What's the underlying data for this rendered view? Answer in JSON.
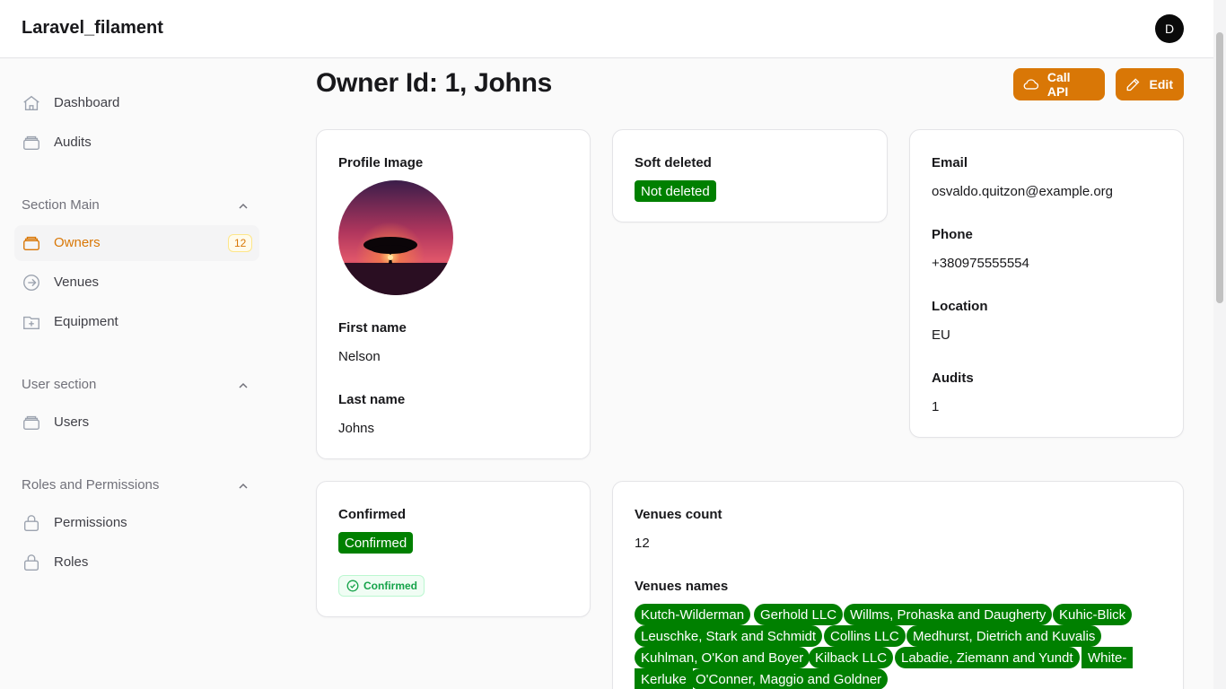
{
  "app": {
    "brand": "Laravel_filament",
    "user_initial": "D"
  },
  "sidebar": {
    "top_items": [
      {
        "label": "Dashboard",
        "icon": "home-icon"
      },
      {
        "label": "Audits",
        "icon": "stack-icon"
      }
    ],
    "groups": [
      {
        "title": "Section Main",
        "items": [
          {
            "label": "Owners",
            "icon": "stack-icon",
            "badge": "12",
            "active": true
          },
          {
            "label": "Venues",
            "icon": "arrow-circle-icon"
          },
          {
            "label": "Equipment",
            "icon": "folder-plus-icon"
          }
        ]
      },
      {
        "title": "User section",
        "items": [
          {
            "label": "Users",
            "icon": "stack-icon"
          }
        ]
      },
      {
        "title": "Roles and Permissions",
        "items": [
          {
            "label": "Permissions",
            "icon": "lock-icon"
          },
          {
            "label": "Roles",
            "icon": "lock-icon"
          }
        ]
      }
    ]
  },
  "header": {
    "title": "Owner Id: 1, Johns",
    "actions": {
      "call_api": "Call API",
      "edit": "Edit"
    },
    "accent_color": "#d97706"
  },
  "profile": {
    "image_label": "Profile Image",
    "first_name_label": "First name",
    "first_name": "Nelson",
    "last_name_label": "Last name",
    "last_name": "Johns"
  },
  "soft_deleted": {
    "label": "Soft deleted",
    "value": "Not deleted"
  },
  "contact": {
    "email_label": "Email",
    "email": "osvaldo.quitzon@example.org",
    "phone_label": "Phone",
    "phone": "+380975555554",
    "location_label": "Location",
    "location": "EU",
    "audits_label": "Audits",
    "audits": "1"
  },
  "confirmed": {
    "label": "Confirmed",
    "badge": "Confirmed",
    "chip": "Confirmed"
  },
  "venues": {
    "count_label": "Venues count",
    "count": "12",
    "names_label": "Venues names",
    "names": [
      "Kutch-Wilderman",
      "Gerhold LLC",
      "Willms, Prohaska and Daugherty",
      "Kuhic-Blick",
      "Leuschke, Stark and Schmidt",
      "Collins LLC",
      "Medhurst, Dietrich and Kuvalis",
      "Kuhlman, O'Kon and Boyer",
      "Kilback LLC",
      "Labadie, Ziemann and Yundt",
      "White-",
      "Kerluke",
      "O'Conner, Maggio and Goldner"
    ],
    "badge_color": "#008000"
  }
}
